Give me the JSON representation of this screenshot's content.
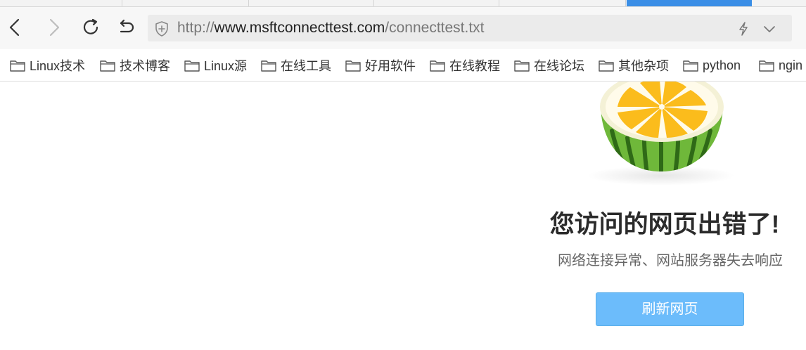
{
  "browser": {
    "address": {
      "scheme": "http://",
      "host": "www.msftconnecttest.com",
      "path": "/connecttest.txt"
    },
    "tabs": [
      {
        "active": false
      },
      {
        "active": false
      },
      {
        "active": false
      },
      {
        "active": false
      },
      {
        "active": false
      },
      {
        "active": true
      }
    ],
    "accent_color": "#3a8ee6"
  },
  "bookmarks": [
    {
      "label": "Linux技术",
      "icon": "folder-icon"
    },
    {
      "label": "技术博客",
      "icon": "folder-icon"
    },
    {
      "label": "Linux源",
      "icon": "folder-icon"
    },
    {
      "label": "在线工具",
      "icon": "folder-icon"
    },
    {
      "label": "好用软件",
      "icon": "folder-icon"
    },
    {
      "label": "在线教程",
      "icon": "folder-icon"
    },
    {
      "label": "在线论坛",
      "icon": "folder-icon"
    },
    {
      "label": "其他杂项",
      "icon": "folder-icon"
    },
    {
      "label": "python",
      "icon": "folder-icon"
    },
    {
      "label": "ngin",
      "icon": "folder-icon"
    }
  ],
  "error_page": {
    "title": "您访问的网页出错了!",
    "subtitle": "网络连接异常、网站服务器失去响应",
    "refresh_label": "刷新网页",
    "button_color": "#6cbcfb",
    "illustration": "watermelon-lemon-icon"
  }
}
